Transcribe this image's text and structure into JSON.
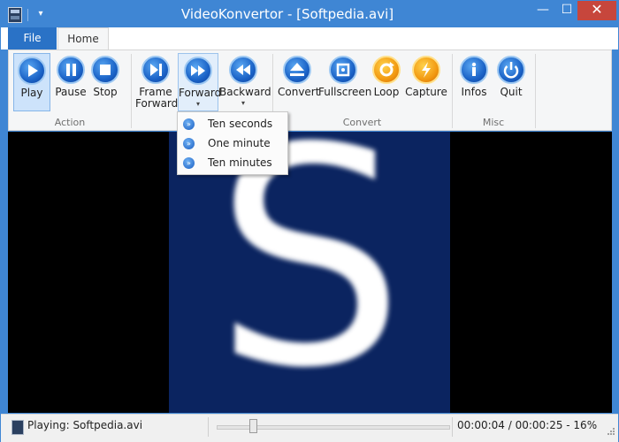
{
  "window": {
    "title": "VideoKonvertor - [Softpedia.avi]"
  },
  "title_buttons": {
    "minimize": "—",
    "maximize": "☐",
    "close": "✕",
    "qat": "▾"
  },
  "tabs": {
    "file": "File",
    "home": "Home"
  },
  "ribbon": {
    "groups": {
      "action": "Action",
      "navigation": "",
      "convert": "Convert",
      "misc": "Misc"
    },
    "buttons": {
      "play": "Play",
      "pause": "Pause",
      "stop": "Stop",
      "frame_forward_1": "Frame",
      "frame_forward_2": "Forward",
      "forward": "Forward",
      "backward": "Backward",
      "convert": "Convert",
      "fullscreen": "Fullscreen",
      "loop": "Loop",
      "capture": "Capture",
      "infos": "Infos",
      "quit": "Quit"
    },
    "dropdown_caret": "▾"
  },
  "forward_menu": {
    "items": [
      "Ten seconds",
      "One minute",
      "Ten minutes"
    ],
    "icon_glyph": "»"
  },
  "video": {
    "frame_letter": "S"
  },
  "status": {
    "playing": "Playing: Softpedia.avi",
    "time": "00:00:04 / 00:00:25 - 16%",
    "progress_percent": 16
  },
  "colors": {
    "titlebar": "#3f86d4",
    "file_tab": "#2a72c6",
    "close": "#c7463c",
    "video_frame": "#0b2460"
  }
}
